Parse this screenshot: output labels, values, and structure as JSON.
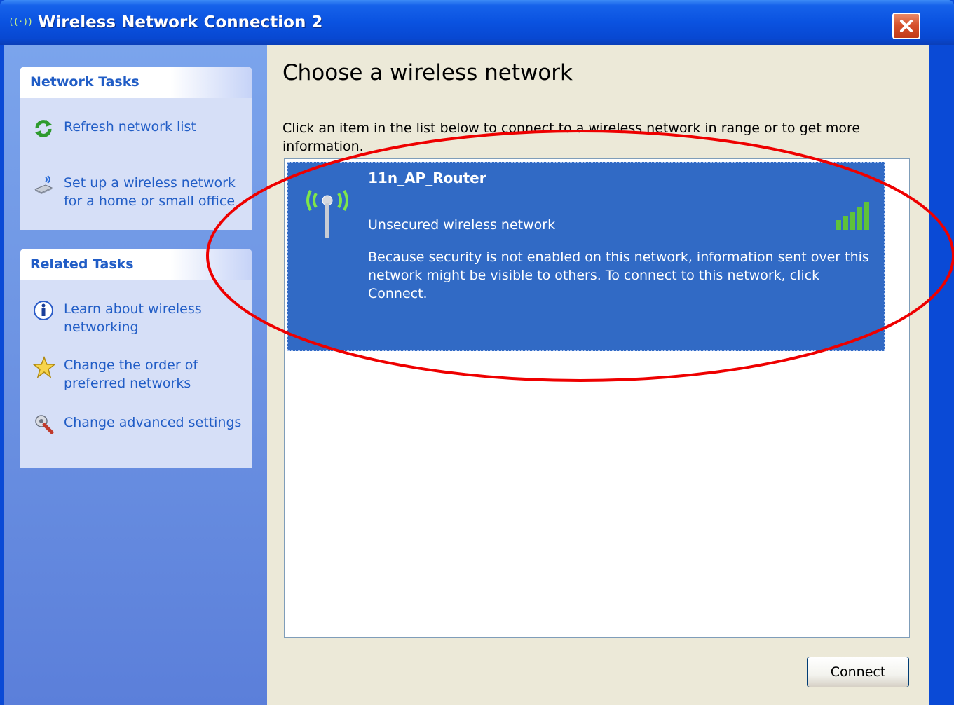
{
  "window": {
    "title": "Wireless Network Connection 2",
    "title_icon_text": "((·))"
  },
  "sidebar": {
    "network_tasks": {
      "title": "Network Tasks",
      "items": [
        {
          "label": "Refresh network list",
          "icon": "refresh-icon"
        },
        {
          "label": "Set up a wireless network for a home or small office",
          "icon": "wireless-setup-icon"
        }
      ]
    },
    "related_tasks": {
      "title": "Related Tasks",
      "items": [
        {
          "label": "Learn about wireless networking",
          "icon": "info-icon"
        },
        {
          "label": "Change the order of preferred networks",
          "icon": "star-icon"
        },
        {
          "label": "Change advanced settings",
          "icon": "settings-icon"
        }
      ]
    }
  },
  "main": {
    "heading": "Choose a wireless network",
    "instructions": "Click an item in the list below to connect to a wireless network in range or to get more information.",
    "networks": [
      {
        "name": "11n_AP_Router",
        "status": "Unsecured wireless network",
        "description": "Because security is not enabled on this network, information sent over this network might be visible to others. To connect to this network, click Connect.",
        "signal_bars": 5,
        "selected": true
      }
    ],
    "connect_label": "Connect"
  },
  "colors": {
    "title_bar": "#0a52e0",
    "sidebar": "#6f96e4",
    "selection": "#316ac5",
    "annotation_ring": "#ee0000",
    "signal_green": "#5fc23a"
  }
}
